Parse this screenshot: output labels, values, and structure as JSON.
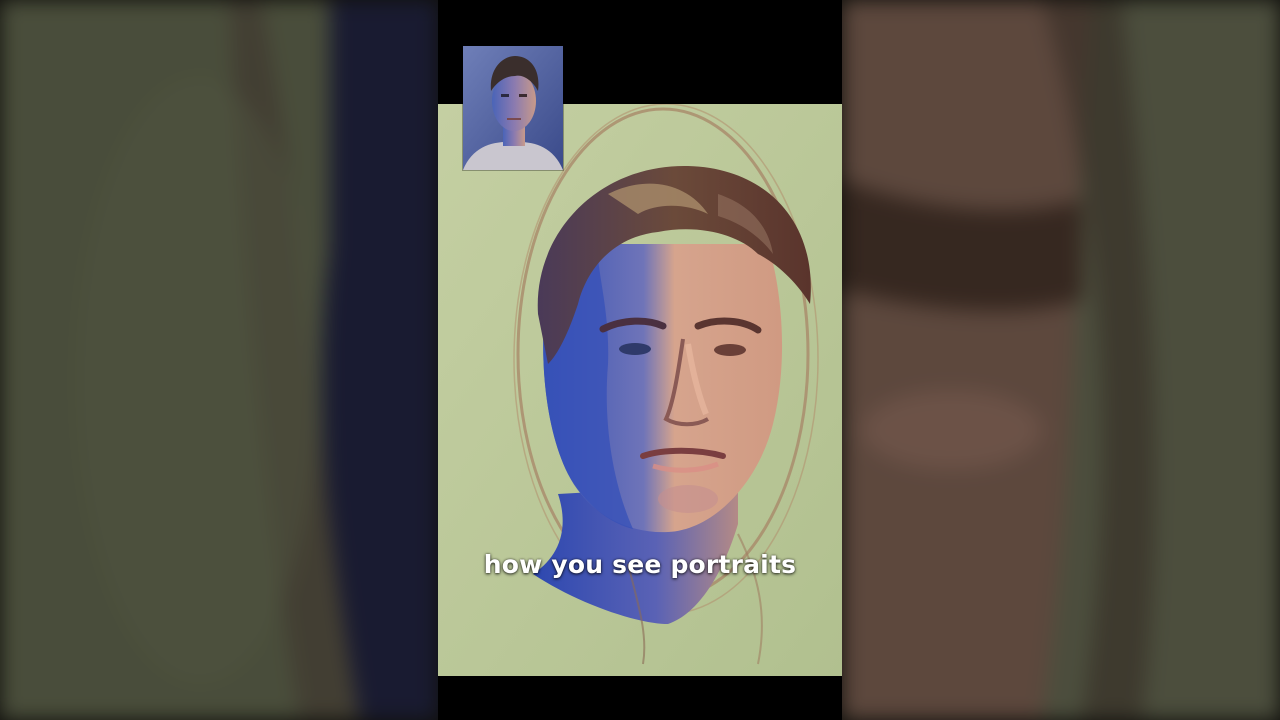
{
  "caption": {
    "text": "how you see portraits"
  },
  "colors": {
    "canvas_green": "#bcc99a",
    "shadow_blue": "#3e5ab8",
    "skin_warm": "#d39f86",
    "hair_brown": "#5b3b2f",
    "letterbox": "#000000"
  },
  "icons": {
    "reference_photo": "reference-photo-thumbnail",
    "painting": "oil-portrait-painting"
  }
}
